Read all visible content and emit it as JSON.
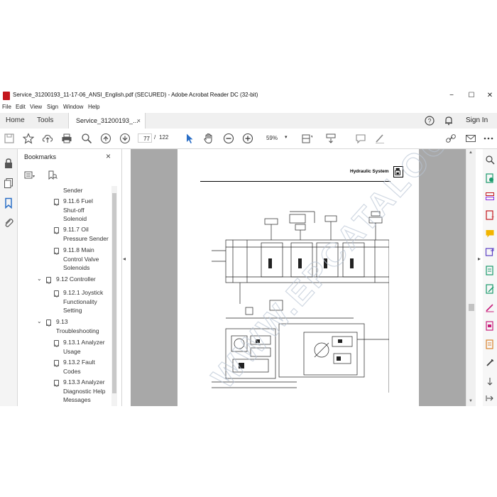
{
  "window": {
    "title": "Service_31200193_11-17-06_ANSI_English.pdf (SECURED) - Adobe Acrobat Reader DC (32-bit)",
    "minimize": "−",
    "maximize": "☐",
    "close": "✕"
  },
  "menu": [
    "File",
    "Edit",
    "View",
    "Sign",
    "Window",
    "Help"
  ],
  "tabs": {
    "home": "Home",
    "tools": "Tools",
    "document": "Service_31200193_...",
    "document_close": "×",
    "sign_in": "Sign In"
  },
  "toolbar": {
    "current_page": "77",
    "page_separator": "/",
    "total_pages": "122",
    "zoom": "59%"
  },
  "bookmarks": {
    "header": "Bookmarks",
    "close": "×",
    "items": [
      {
        "lines": [
          "Sender"
        ]
      },
      {
        "lines": [
          "9.11.6 Fuel",
          "Shut-off",
          "Solenoid"
        ]
      },
      {
        "lines": [
          "9.11.7 Oil",
          "Pressure Sender"
        ]
      },
      {
        "lines": [
          "9.11.8 Main",
          "Control Valve",
          "Solenoids"
        ]
      },
      {
        "lines": [
          "9.12 Controller"
        ]
      },
      {
        "lines": [
          "9.12.1 Joystick",
          "Functionality",
          "Setting"
        ]
      },
      {
        "lines": [
          "9.13",
          "Troubleshooting"
        ]
      },
      {
        "lines": [
          "9.13.1 Analyzer",
          "Usage"
        ]
      },
      {
        "lines": [
          "9.13.2 Fault",
          "Codes"
        ]
      },
      {
        "lines": [
          "9.13.3 Analyzer",
          "Diagnostic Help",
          "Messages"
        ]
      }
    ]
  },
  "document": {
    "page_header": "Hydraulic System",
    "watermark": "WWW.EPCATALOG.COM"
  },
  "colors": {
    "accent_blue": "#2a6ec6",
    "doc_background": "#a8a8a8",
    "pdf_red": "#c4161c"
  }
}
